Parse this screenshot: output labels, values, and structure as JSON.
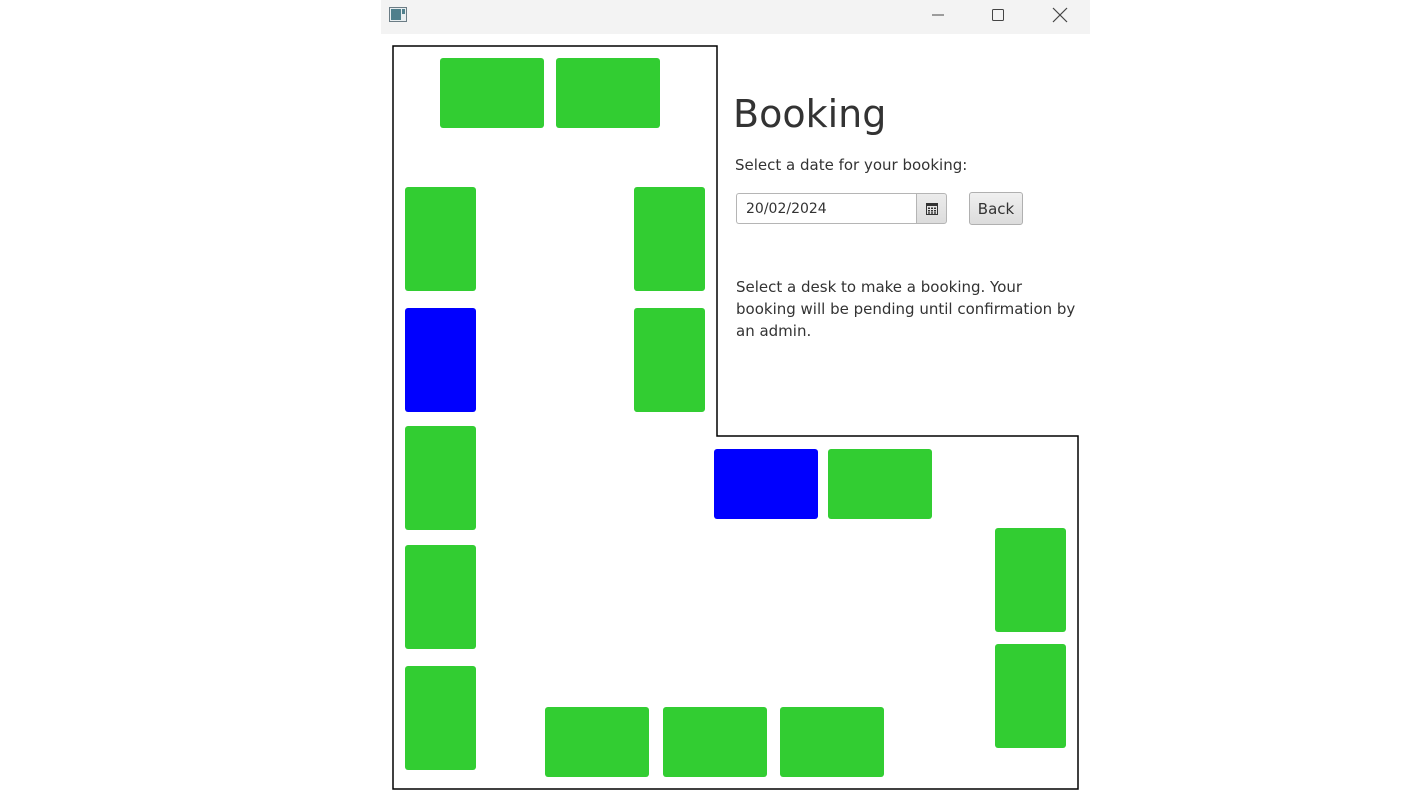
{
  "window": {
    "app_icon": "app-window-icon",
    "controls": {
      "minimize": "minimize-icon",
      "maximize": "maximize-icon",
      "close": "close-icon"
    }
  },
  "booking": {
    "title": "Booking",
    "date_prompt": "Select a date for your booking:",
    "date_value": "20/02/2024",
    "calendar_icon": "calendar-icon",
    "back_label": "Back",
    "info_text": "Select a desk to make a booking. Your booking will be pending until confirmation by an admin."
  },
  "colors": {
    "available": "#32cd32",
    "booked": "#0000ff",
    "wall": "#000000"
  },
  "desks": [
    {
      "status": "available"
    },
    {
      "status": "available"
    },
    {
      "status": "available"
    },
    {
      "status": "available"
    },
    {
      "status": "booked"
    },
    {
      "status": "available"
    },
    {
      "status": "available"
    },
    {
      "status": "available"
    },
    {
      "status": "available"
    },
    {
      "status": "booked"
    },
    {
      "status": "available"
    },
    {
      "status": "available"
    },
    {
      "status": "available"
    },
    {
      "status": "available"
    },
    {
      "status": "available"
    },
    {
      "status": "available"
    }
  ]
}
